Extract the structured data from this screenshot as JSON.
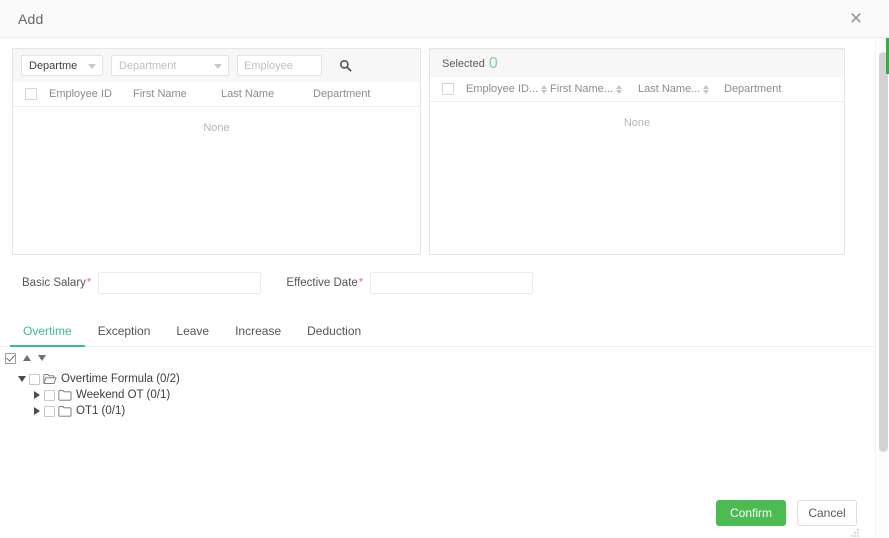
{
  "window": {
    "title": "Add",
    "close_icon": "close-icon"
  },
  "transfer": {
    "source": {
      "filters": {
        "dept_type_value": "Departme",
        "dept_type_icon": "chevron-down-icon",
        "dept_placeholder": "Department",
        "dept_value": "",
        "dept_icon": "chevron-down-icon",
        "employee_placeholder": "Employee",
        "employee_value": "",
        "search_icon": "search-icon"
      },
      "columns": [
        {
          "label": "Employee ID",
          "sortable": false
        },
        {
          "label": "First Name",
          "sortable": false
        },
        {
          "label": "Last Name",
          "sortable": false
        },
        {
          "label": "Department",
          "sortable": false
        }
      ],
      "empty_text": "None"
    },
    "target": {
      "selected_label": "Selected",
      "selected_count": "0",
      "columns": [
        {
          "label": "Employee ID...",
          "sortable": true
        },
        {
          "label": "First Name...",
          "sortable": true
        },
        {
          "label": "Last Name...",
          "sortable": true
        },
        {
          "label": "Department",
          "sortable": false
        }
      ],
      "empty_text": "None"
    }
  },
  "form": {
    "basic_salary": {
      "label": "Basic Salary",
      "required_mark": "*",
      "value": "",
      "placeholder": ""
    },
    "effective_date": {
      "label": "Effective Date",
      "required_mark": "*",
      "value": "",
      "placeholder": ""
    }
  },
  "tabs": {
    "active": "Overtime",
    "items": [
      {
        "label": "Overtime"
      },
      {
        "label": "Exception"
      },
      {
        "label": "Leave"
      },
      {
        "label": "Increase"
      },
      {
        "label": "Deduction"
      }
    ]
  },
  "tree_toolbar": {
    "select_all_icon": "checkbox-checked-icon",
    "collapse_icon": "chevron-up-icon",
    "expand_icon": "chevron-down-icon"
  },
  "tree": {
    "nodes": [
      {
        "label": "Overtime Formula (0/2)",
        "level": 0,
        "expanded": true,
        "arrow_icon": "chevron-down-icon",
        "folder_icon": "folder-open-icon",
        "checked": false
      },
      {
        "label": "Weekend OT (0/1)",
        "level": 1,
        "expanded": false,
        "arrow_icon": "chevron-right-icon",
        "folder_icon": "folder-icon",
        "checked": false
      },
      {
        "label": "OT1 (0/1)",
        "level": 1,
        "expanded": false,
        "arrow_icon": "chevron-right-icon",
        "folder_icon": "folder-icon",
        "checked": false
      }
    ]
  },
  "footer": {
    "confirm_label": "Confirm",
    "cancel_label": "Cancel"
  },
  "colors": {
    "accent_green": "#3bbd93",
    "confirm_green": "#4cbb52",
    "required_red": "#e8747c",
    "count_green": "#7ed49a"
  }
}
